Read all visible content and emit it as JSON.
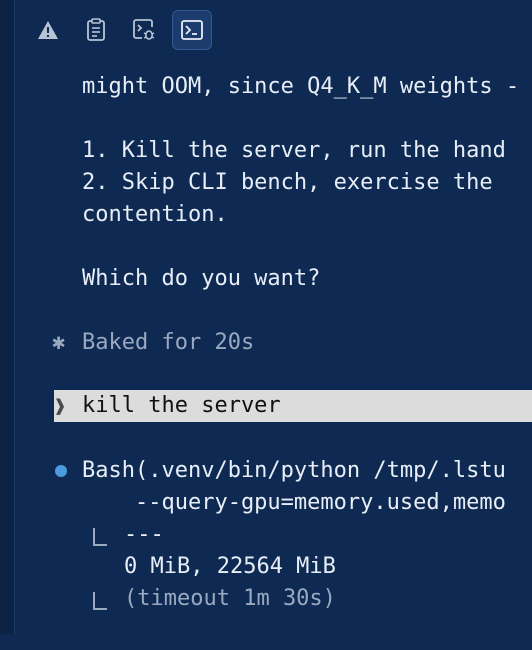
{
  "toolbar": {
    "buttons": [
      {
        "icon": "warning-icon",
        "active": false
      },
      {
        "icon": "notes-icon",
        "active": false
      },
      {
        "icon": "debug-terminal-icon",
        "active": false
      },
      {
        "icon": "terminal-icon",
        "active": true
      }
    ]
  },
  "transcript": {
    "oom_line": "might OOM, since Q4_K_M weights -",
    "option_1": "1. Kill the server, run the hand",
    "option_2": "2. Skip CLI bench, exercise the ",
    "option_2_cont": "contention.",
    "question": "Which do you want?",
    "status_glyph": "✱",
    "status_text": "Baked for 20s"
  },
  "prompt": {
    "chevron": "❱",
    "text": "kill the server"
  },
  "tool_call": {
    "command_line": "Bash(.venv/bin/python /tmp/.lstu",
    "command_cont": "    --query-gpu=memory.used,memo",
    "output_1": "---",
    "output_2": "0 MiB, 22564 MiB",
    "timeout": "(timeout 1m 30s)"
  },
  "colors": {
    "background": "#0f2a52",
    "text": "#e8eef7",
    "muted": "#9aa9bf",
    "bullet": "#4a9be0",
    "prompt_highlight": "#dcdcdc"
  }
}
